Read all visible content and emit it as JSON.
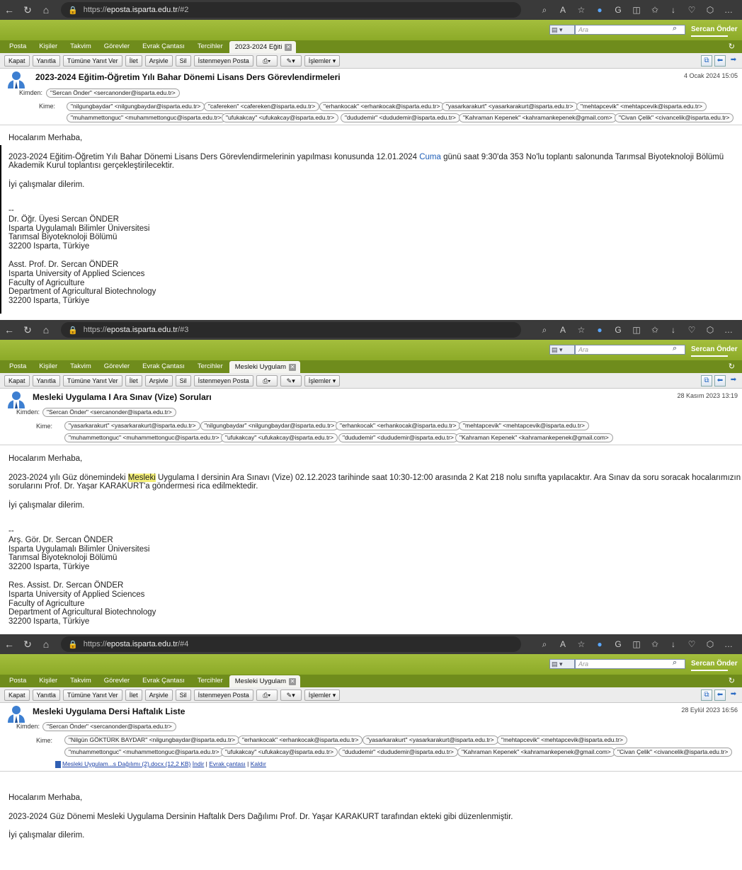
{
  "browser": {
    "url_prefix": "https://",
    "url_host": "eposta.isparta.edu.tr",
    "icons": [
      "back-icon",
      "refresh-icon",
      "home-icon",
      "lock-icon",
      "search-icon",
      "read-aloud-icon",
      "favorite-icon",
      "copilot-icon",
      "split-icon",
      "favorites-icon",
      "downloads-icon",
      "extensions-icon",
      "more-icon"
    ]
  },
  "app": {
    "search_placeholder": "Ara",
    "user": "Sercan Önder",
    "tabs": [
      "Posta",
      "Kişiler",
      "Takvim",
      "Görevler",
      "Evrak Çantası",
      "Tercihler"
    ],
    "toolbar": [
      "Kapat",
      "Yanıtla",
      "Tümüne Yanıt Ver",
      "İlet",
      "Arşivle",
      "Sil",
      "İstenmeyen Posta"
    ],
    "actions_label": "İşlemler",
    "from_label": "Kimden:",
    "to_label": "Kime:"
  },
  "emails": [
    {
      "url_suffix": "/#2",
      "active_tab": "2023-2024 Eğiti",
      "subject": "2023-2024 Eğitim-Öğretim Yılı Bahar Dönemi Lisans Ders Görevlendirmeleri",
      "date": "4 Ocak 2024 15:05",
      "from": "\"Sercan Önder\" <sercanonder@isparta.edu.tr>",
      "to_row1": [
        "\"nilgungbaydar\" <nilgungbaydar@isparta.edu.tr>",
        "\"cafereken\" <cafereken@isparta.edu.tr>",
        "\"erhankocak\" <erhankocak@isparta.edu.tr>",
        "\"yasarkarakurt\" <yasarkarakurt@isparta.edu.tr>",
        "\"mehtapcevik\" <mehtapcevik@isparta.edu.tr>"
      ],
      "to_row2": [
        "\"muhammettonguc\" <muhammettonguc@isparta.edu.tr>",
        "\"ufukakcay\" <ufukakcay@isparta.edu.tr>",
        "\"dududemir\" <dududemir@isparta.edu.tr>",
        "\"Kahraman Kepenek\" <kahramankepenek@gmail.com>",
        "\"Civan Çelik\" <civancelik@isparta.edu.tr>"
      ],
      "greeting": "Hocalarım Merhaba,",
      "para_a": "2023-2024 Eğitim-Öğretim Yılı Bahar Dönemi Lisans Ders Görevlendirmelerinin yapılması konusunda 12.01.2024 ",
      "para_link": "Cuma",
      "para_b": " günü saat 9:30'da 353 No'lu toplantı salonunda Tarımsal Biyoteknoloji Bölümü",
      "para_c": "Akademik Kurul toplantısı gerçekleştirilecektir.",
      "closing": "İyi çalışmalar dilerim.",
      "sig_sep": "--",
      "sig_tr": [
        "Dr. Öğr. Üyesi Sercan ÖNDER",
        "Isparta Uygulamalı Bilimler Üniversitesi",
        "Tarımsal Biyoteknoloji Bölümü",
        "32200 Isparta, Türkiye"
      ],
      "sig_en": [
        "Asst. Prof. Dr. Sercan ÖNDER",
        "Isparta University of Applied Sciences",
        "Faculty of Agriculture",
        "Department of Agricultural Biotechnology",
        "32200 Isparta, Türkiye"
      ]
    },
    {
      "url_suffix": "/#3",
      "active_tab": "Mesleki Uygulam",
      "subject": "Mesleki Uygulama I Ara Sınav (Vize) Soruları",
      "date": "28 Kasım 2023 13:19",
      "from": "\"Sercan Önder\" <sercanonder@isparta.edu.tr>",
      "to_row1": [
        "\"yasarkarakurt\" <yasarkarakurt@isparta.edu.tr>",
        "\"nilgungbaydar\" <nilgungbaydar@isparta.edu.tr>",
        "\"erhankocak\" <erhankocak@isparta.edu.tr>",
        "\"mehtapcevik\" <mehtapcevik@isparta.edu.tr>"
      ],
      "to_row2": [
        "\"muhammettonguc\" <muhammettonguc@isparta.edu.tr>",
        "\"ufukakcay\" <ufukakcay@isparta.edu.tr>",
        "\"dududemir\" <dududemir@isparta.edu.tr>",
        "\"Kahraman Kepenek\" <kahramankepenek@gmail.com>"
      ],
      "greeting": "Hocalarım Merhaba,",
      "para_a": "2023-2024 yılı Güz dönemindeki ",
      "para_hl": "Mesleki",
      "para_b": " Uygulama I dersinin Ara Sınavı (Vize) 02.12.2023 tarihinde saat 10:30-12:00 arasında 2 Kat 218 nolu sınıfta yapılacaktır. Ara Sınav da soru soracak hocalarımızın",
      "para_c": "sorularını Prof. Dr. Yaşar KARAKURT'a göndermesi rica edilmektedir.",
      "closing": "İyi çalışmalar dilerim.",
      "sig_sep": "--",
      "sig_tr": [
        "Arş. Gör. Dr. Sercan ÖNDER",
        "Isparta Uygulamalı Bilimler Üniversitesi",
        "Tarımsal Biyoteknoloji Bölümü",
        "32200 Isparta, Türkiye"
      ],
      "sig_en": [
        "Res. Assist. Dr. Sercan ÖNDER",
        "Isparta University of Applied Sciences",
        "Faculty of Agriculture",
        "Department of Agricultural Biotechnology",
        "32200 Isparta, Türkiye"
      ]
    },
    {
      "url_suffix": "/#4",
      "active_tab": "Mesleki Uygulam",
      "subject": "Mesleki Uygulama Dersi Haftalık Liste",
      "date": "28 Eylül 2023 16:56",
      "from": "\"Sercan Önder\" <sercanonder@isparta.edu.tr>",
      "to_row1": [
        "\"Nilgün GÖKTÜRK BAYDAR\" <nilgungbaydar@isparta.edu.tr>",
        "\"erhankocak\" <erhankocak@isparta.edu.tr>",
        "\"yasarkarakurt\" <yasarkarakurt@isparta.edu.tr>",
        "\"mehtapcevik\" <mehtapcevik@isparta.edu.tr>"
      ],
      "to_row2": [
        "\"muhammettonguc\" <muhammettonguc@isparta.edu.tr>",
        "\"ufukakcay\" <ufukakcay@isparta.edu.tr>",
        "\"dududemir\" <dududemir@isparta.edu.tr>",
        "\"Kahraman Kepenek\" <kahramankepenek@gmail.com>",
        "\"Civan Çelik\" <civancelik@isparta.edu.tr>"
      ],
      "attachment": "Mesleki Uygulam...s Dağılımı (2).docx (12,2 KB)",
      "attach_links": [
        "İndir",
        "Evrak çantası",
        "Kaldır"
      ],
      "greeting": "Hocalarım Merhaba,",
      "para_a": "2023-2024 Güz Dönemi Mesleki Uygulama Dersinin Haftalık Ders Dağılımı Prof. Dr. Yaşar KARAKURT tarafından ekteki gibi düzenlenmiştir.",
      "closing": "İyi çalışmalar dilerim."
    }
  ]
}
